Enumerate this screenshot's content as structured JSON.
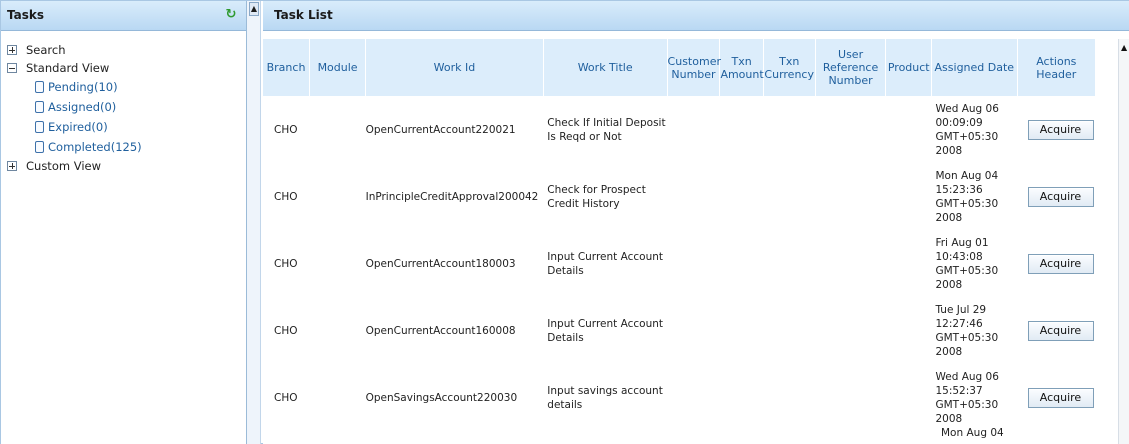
{
  "tasks": {
    "title": "Tasks",
    "refresh_icon": "refresh-icon",
    "tree": [
      {
        "label": "Search",
        "expanded": false
      },
      {
        "label": "Standard View",
        "expanded": true,
        "children": [
          {
            "label": "Pending(10)"
          },
          {
            "label": "Assigned(0)"
          },
          {
            "label": "Expired(0)"
          },
          {
            "label": "Completed(125)"
          }
        ]
      },
      {
        "label": "Custom View",
        "expanded": false
      }
    ]
  },
  "task_list": {
    "title": "Task List",
    "columns": [
      "Branch",
      "Module",
      "Work Id",
      "Work Title",
      "Customer Number",
      "Txn Amount",
      "Txn Currency",
      "User Reference Number",
      "Product",
      "Assigned Date",
      "Actions Header"
    ],
    "rows": [
      {
        "branch": "CHO",
        "module": "",
        "work_id": "OpenCurrentAccount220021",
        "work_title": "Check If Initial Deposit Is Reqd or Not",
        "customer_number": "",
        "txn_amount": "",
        "txn_currency": "",
        "user_reference_number": "",
        "product": "",
        "assigned_date": "Wed Aug 06 00:09:09 GMT+05:30 2008",
        "action": "Acquire"
      },
      {
        "branch": "CHO",
        "module": "",
        "work_id": "InPrincipleCreditApproval200042",
        "work_title": "Check for Prospect Credit History",
        "customer_number": "",
        "txn_amount": "",
        "txn_currency": "",
        "user_reference_number": "",
        "product": "",
        "assigned_date": "Mon Aug 04 15:23:36 GMT+05:30 2008",
        "action": "Acquire"
      },
      {
        "branch": "CHO",
        "module": "",
        "work_id": "OpenCurrentAccount180003",
        "work_title": "Input Current Account Details",
        "customer_number": "",
        "txn_amount": "",
        "txn_currency": "",
        "user_reference_number": "",
        "product": "",
        "assigned_date": "Fri Aug 01 10:43:08 GMT+05:30 2008",
        "action": "Acquire"
      },
      {
        "branch": "CHO",
        "module": "",
        "work_id": "OpenCurrentAccount160008",
        "work_title": "Input Current Account Details",
        "customer_number": "",
        "txn_amount": "",
        "txn_currency": "",
        "user_reference_number": "",
        "product": "",
        "assigned_date": "Tue Jul 29 12:27:46 GMT+05:30 2008",
        "action": "Acquire"
      },
      {
        "branch": "CHO",
        "module": "",
        "work_id": "OpenSavingsAccount220030",
        "work_title": "Input savings account details",
        "customer_number": "",
        "txn_amount": "",
        "txn_currency": "",
        "user_reference_number": "",
        "product": "",
        "assigned_date": "Wed Aug 06 15:52:37 GMT+05:30 2008",
        "action": "Acquire"
      }
    ],
    "partial_next_date": "Mon Aug 04"
  }
}
